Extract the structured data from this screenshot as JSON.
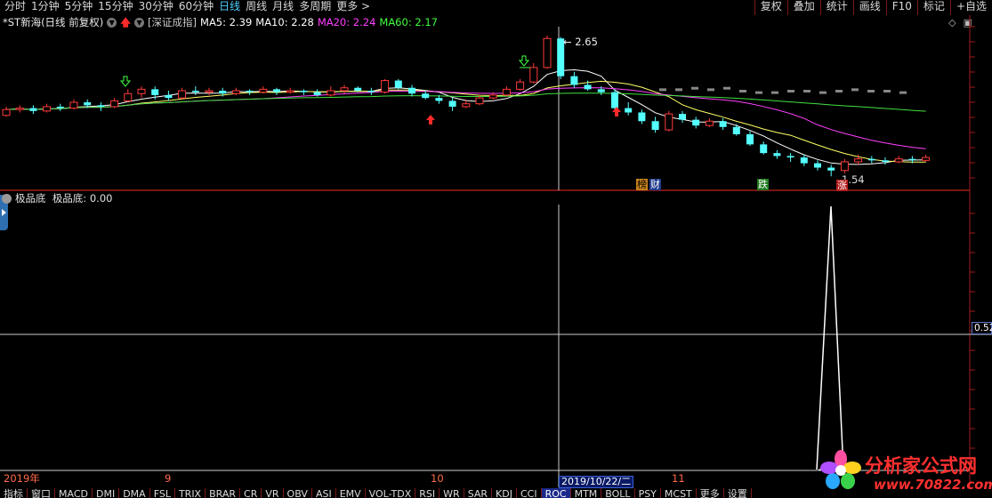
{
  "top_tabs": [
    "分时",
    "1分钟",
    "5分钟",
    "15分钟",
    "30分钟",
    "60分钟",
    "日线",
    "周线",
    "月线",
    "多周期",
    "更多 >"
  ],
  "active_tab": "日线",
  "right_tools": [
    "复权",
    "叠加",
    "统计",
    "画线",
    "F10",
    "标记",
    "+自选"
  ],
  "info": {
    "symbol": "*ST新海(日线 前复权)",
    "index": "[深证成指]",
    "ma5": "MA5: 2.39",
    "ma10": "MA10: 2.28",
    "ma20": "MA20: 2.24",
    "ma60": "MA60: 2.17"
  },
  "price_high_label": "2.65",
  "price_low_label": "1.54",
  "badges": {
    "bang": "榜",
    "cai": "财",
    "die": "跌",
    "zhang": "涨"
  },
  "indicator": {
    "title": "极品底",
    "value_line": "极品底: 0.00",
    "axis_value": "0.52"
  },
  "dates": {
    "y2019": "2019年",
    "m9": "9",
    "m10": "10",
    "m11": "11",
    "cursor": "2019/10/22/二"
  },
  "bottom_tabs": [
    "指标",
    "窗口",
    "MACD",
    "DMI",
    "DMA",
    "FSL",
    "TRIX",
    "BRAR",
    "CR",
    "VR",
    "OBV",
    "ASI",
    "EMV",
    "VOL-TDX",
    "RSI",
    "WR",
    "SAR",
    "KDJ",
    "CCI",
    "ROC",
    "MTM",
    "BOLL",
    "PSY",
    "MCST",
    "更多",
    "设置"
  ],
  "logo": {
    "text": "分析家公式网",
    "url": "www.70822.com"
  },
  "colors": {
    "up": "#ff3a3a",
    "down": "#54ffff",
    "ma5": "#ffffff",
    "ma10": "#ffff66",
    "ma20": "#ff40ff",
    "ma60": "#40e040",
    "cursor": "#3b5fd6"
  },
  "chart_data": {
    "type": "candlestick",
    "symbol": "*ST新海",
    "high_label": 2.65,
    "low_label": 1.54,
    "candles": [
      [
        2.1,
        2.14,
        2.09,
        2.16
      ],
      [
        2.14,
        2.15,
        2.12,
        2.17
      ],
      [
        2.15,
        2.13,
        2.11,
        2.17
      ],
      [
        2.13,
        2.16,
        2.12,
        2.18
      ],
      [
        2.16,
        2.15,
        2.13,
        2.18
      ],
      [
        2.15,
        2.19,
        2.14,
        2.21
      ],
      [
        2.19,
        2.17,
        2.15,
        2.21
      ],
      [
        2.17,
        2.16,
        2.13,
        2.19
      ],
      [
        2.16,
        2.2,
        2.15,
        2.22
      ],
      [
        2.2,
        2.25,
        2.19,
        2.28
      ],
      [
        2.25,
        2.28,
        2.22,
        2.3
      ],
      [
        2.28,
        2.24,
        2.21,
        2.3
      ],
      [
        2.24,
        2.22,
        2.2,
        2.27
      ],
      [
        2.22,
        2.27,
        2.21,
        2.29
      ],
      [
        2.27,
        2.26,
        2.24,
        2.3
      ],
      [
        2.26,
        2.27,
        2.24,
        2.29
      ],
      [
        2.27,
        2.25,
        2.23,
        2.29
      ],
      [
        2.25,
        2.27,
        2.24,
        2.29
      ],
      [
        2.27,
        2.26,
        2.24,
        2.28
      ],
      [
        2.26,
        2.28,
        2.25,
        2.3
      ],
      [
        2.28,
        2.26,
        2.24,
        2.29
      ],
      [
        2.26,
        2.27,
        2.25,
        2.29
      ],
      [
        2.27,
        2.26,
        2.24,
        2.28
      ],
      [
        2.26,
        2.24,
        2.23,
        2.28
      ],
      [
        2.24,
        2.27,
        2.23,
        2.3
      ],
      [
        2.27,
        2.29,
        2.25,
        2.31
      ],
      [
        2.29,
        2.27,
        2.26,
        2.3
      ],
      [
        2.27,
        2.26,
        2.24,
        2.29
      ],
      [
        2.26,
        2.34,
        2.25,
        2.35
      ],
      [
        2.34,
        2.29,
        2.28,
        2.35
      ],
      [
        2.29,
        2.25,
        2.23,
        2.31
      ],
      [
        2.25,
        2.22,
        2.21,
        2.27
      ],
      [
        2.22,
        2.2,
        2.18,
        2.24
      ],
      [
        2.2,
        2.16,
        2.13,
        2.22
      ],
      [
        2.16,
        2.18,
        2.15,
        2.21
      ],
      [
        2.18,
        2.22,
        2.17,
        2.24
      ],
      [
        2.22,
        2.24,
        2.21,
        2.26
      ],
      [
        2.24,
        2.28,
        2.23,
        2.3
      ],
      [
        2.28,
        2.33,
        2.27,
        2.35
      ],
      [
        2.33,
        2.43,
        2.32,
        2.46
      ],
      [
        2.43,
        2.63,
        2.42,
        2.65
      ],
      [
        2.63,
        2.37,
        2.35,
        2.64
      ],
      [
        2.37,
        2.31,
        2.29,
        2.4
      ],
      [
        2.31,
        2.28,
        2.27,
        2.34
      ],
      [
        2.28,
        2.26,
        2.24,
        2.3
      ],
      [
        2.26,
        2.15,
        2.13,
        2.28
      ],
      [
        2.15,
        2.12,
        2.1,
        2.19
      ],
      [
        2.12,
        2.06,
        2.04,
        2.14
      ],
      [
        2.06,
        2.0,
        1.98,
        2.09
      ],
      [
        2.0,
        2.11,
        1.99,
        2.13
      ],
      [
        2.11,
        2.07,
        2.05,
        2.13
      ],
      [
        2.07,
        2.03,
        2.01,
        2.09
      ],
      [
        2.03,
        2.06,
        2.02,
        2.08
      ],
      [
        2.06,
        2.02,
        2.0,
        2.08
      ],
      [
        2.02,
        1.97,
        1.96,
        2.04
      ],
      [
        1.97,
        1.9,
        1.89,
        1.99
      ],
      [
        1.9,
        1.84,
        1.83,
        1.92
      ],
      [
        1.84,
        1.82,
        1.8,
        1.86
      ],
      [
        1.82,
        1.81,
        1.78,
        1.84
      ],
      [
        1.81,
        1.77,
        1.75,
        1.83
      ],
      [
        1.77,
        1.74,
        1.72,
        1.79
      ],
      [
        1.74,
        1.72,
        1.54,
        1.76
      ],
      [
        1.72,
        1.78,
        1.7,
        1.8
      ],
      [
        1.78,
        1.8,
        1.76,
        1.83
      ],
      [
        1.8,
        1.79,
        1.77,
        1.82
      ],
      [
        1.79,
        1.78,
        1.76,
        1.81
      ],
      [
        1.78,
        1.8,
        1.77,
        1.82
      ],
      [
        1.8,
        1.79,
        1.77,
        1.82
      ],
      [
        1.79,
        1.81,
        1.78,
        1.83
      ]
    ],
    "ghost_candles": [
      2.28,
      2.28,
      2.29,
      2.28,
      2.29,
      2.27,
      2.26,
      2.26,
      2.27,
      2.27,
      2.26,
      2.27,
      2.28,
      2.27,
      2.27,
      2.26
    ],
    "indicator_series": {
      "name": "极品底",
      "value_at_cursor": 0.0,
      "spike_value": 1.0,
      "axis_label": 0.52
    }
  }
}
